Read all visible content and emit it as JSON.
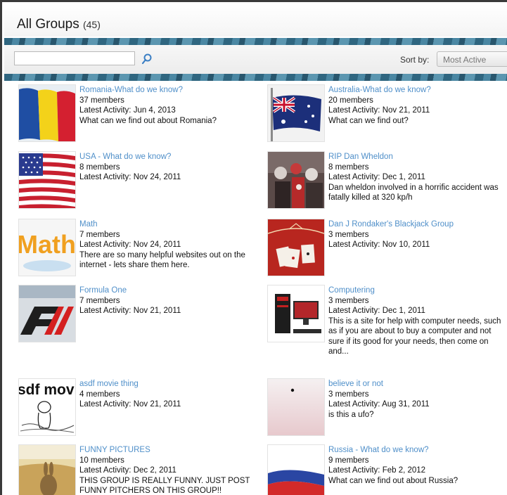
{
  "header": {
    "title": "All Groups",
    "count": "(45)"
  },
  "search": {
    "placeholder": "",
    "value": ""
  },
  "sort": {
    "label": "Sort by:",
    "selected": "Most Active"
  },
  "groups": [
    {
      "name": "Romania-What do we know?",
      "members": "37 members",
      "activity": "Latest Activity: Jun 4, 2013",
      "description": "What can we find out about Romania?"
    },
    {
      "name": "Australia-What do we know?",
      "members": "20 members",
      "activity": "Latest Activity: Nov 21, 2011",
      "description": "What can we find out?"
    },
    {
      "name": "USA - What do we know?",
      "members": "8 members",
      "activity": "Latest Activity: Nov 24, 2011",
      "description": ""
    },
    {
      "name": "RIP Dan Wheldon",
      "members": "8 members",
      "activity": "Latest Activity: Dec 1, 2011",
      "description": "Dan wheldon involved in a horrific accident was fatally killed at 320 kp/h"
    },
    {
      "name": "Math",
      "members": "7 members",
      "activity": "Latest Activity: Nov 24, 2011",
      "description": "There are so many helpful websites out on the internet - lets share them here."
    },
    {
      "name": "Dan J Rondaker's Blackjack Group",
      "members": "3 members",
      "activity": "Latest Activity: Nov 10, 2011",
      "description": ""
    },
    {
      "name": "Formula One",
      "members": "7 members",
      "activity": "Latest Activity: Nov 21, 2011",
      "description": ""
    },
    {
      "name": "Computering",
      "members": "3 members",
      "activity": "Latest Activity: Dec 1, 2011",
      "description": "This is a site for help with computer needs, such as if you are about to buy a computer and not sure if its good for your needs, then come on and..."
    },
    {
      "name": "asdf movie thing",
      "members": "4 members",
      "activity": "Latest Activity: Nov 21, 2011",
      "description": ""
    },
    {
      "name": "believe it or not",
      "members": "3 members",
      "activity": "Latest Activity: Aug 31, 2011",
      "description": "is this a ufo?"
    },
    {
      "name": "FUNNY PICTURES",
      "members": "10 members",
      "activity": "Latest Activity: Dec 2, 2011",
      "description": "THIS GROUP IS REALLY FUNNY. JUST POST FUNNY PITCHERS ON THIS GROUP!!"
    },
    {
      "name": "Russia - What do we know?",
      "members": "9 members",
      "activity": "Latest Activity: Feb 2, 2012",
      "description": "What can we find out about Russia?"
    }
  ],
  "thumbnails": {
    "math_text": "Math",
    "asdf_text": "sdf movi"
  },
  "colors": {
    "link": "#4f8fc9",
    "band": "#3a7590"
  }
}
